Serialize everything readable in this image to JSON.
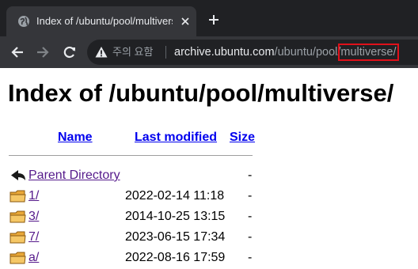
{
  "browser": {
    "tab": {
      "title": "Index of /ubuntu/pool/multiverse/",
      "favicon_icon": "globe-icon",
      "close_icon": "close-icon"
    },
    "new_tab_icon": "plus-icon",
    "nav": {
      "back_icon": "back-arrow-icon",
      "forward_icon": "forward-arrow-icon",
      "reload_icon": "reload-icon"
    },
    "omnibox": {
      "security_icon": "warning-triangle-icon",
      "security_text": "주의 요함",
      "separator": "|",
      "url_host": "archive.ubuntu.com",
      "url_path": "/ubuntu/pool/",
      "url_highlight": "multiverse/",
      "highlight_color": "#e0101a"
    }
  },
  "page": {
    "title": "Index of /ubuntu/pool/multiverse/",
    "columns": [
      "Name",
      "Last modified",
      "Size"
    ],
    "rows": [
      {
        "icon": "back-arrow-icon",
        "name": "Parent Directory",
        "modified": "",
        "size": "-"
      },
      {
        "icon": "folder-icon",
        "name": "1/",
        "modified": "2022-02-14 11:18",
        "size": "-"
      },
      {
        "icon": "folder-icon",
        "name": "3/",
        "modified": "2014-10-25 13:15",
        "size": "-"
      },
      {
        "icon": "folder-icon",
        "name": "7/",
        "modified": "2023-06-15 17:34",
        "size": "-"
      },
      {
        "icon": "folder-icon",
        "name": "a/",
        "modified": "2022-08-16 17:59",
        "size": "-"
      }
    ]
  }
}
